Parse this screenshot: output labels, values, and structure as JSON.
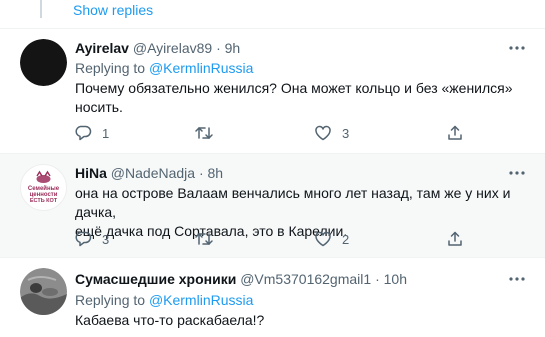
{
  "thread": {
    "show_replies": "Show replies"
  },
  "tweets": [
    {
      "name": "Ayirelav",
      "handle": "@Ayirelav89",
      "dot": "·",
      "time": "9h",
      "replying_prefix": "Replying to",
      "replying_to": "@KermlinRussia",
      "text_lines": [
        "Почему обязательно женился? Она может кольцо и без «женился»",
        "носить."
      ],
      "replies": "1",
      "retweets": "",
      "likes": "3"
    },
    {
      "name": "HiNa",
      "handle": "@NadeNadja",
      "dot": "·",
      "time": "8h",
      "avatar_text": [
        "Семейные",
        "ценности",
        "ЕСТЬ КОТ"
      ],
      "text_lines": [
        "она на острове Валаам венчались много лет назад, там же у них и дачка,",
        "ещё дачка под Сортавала, это в Карелии."
      ],
      "replies": "3",
      "retweets": "",
      "likes": "2"
    },
    {
      "name": "Сумасшедшие хроники",
      "handle": "@Vm5370162gmail1",
      "dot": "·",
      "time": "10h",
      "replying_prefix": "Replying to",
      "replying_to": "@KermlinRussia",
      "text_lines": [
        "Кабаева что-то раскабаела!?"
      ]
    }
  ],
  "colors": {
    "accent": "#1d9bf0",
    "muted": "#536471",
    "text": "#0f1419",
    "highlight_bg": "#f7f9f9"
  },
  "icons": [
    "more-icon",
    "reply-icon",
    "retweet-icon",
    "like-icon",
    "share-icon"
  ]
}
